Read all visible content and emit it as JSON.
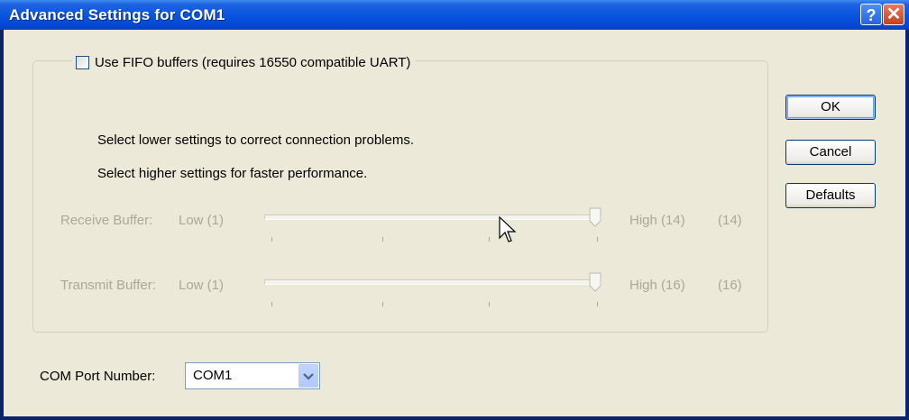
{
  "window": {
    "title": "Advanced Settings for COM1",
    "help_glyph": "?",
    "close_glyph": "✕"
  },
  "fifo": {
    "checkbox_label": "Use FIFO buffers (requires 16550 compatible UART)",
    "checked": false,
    "hint_lower": "Select lower settings to correct connection problems.",
    "hint_higher": "Select higher settings for faster performance.",
    "receive": {
      "label": "Receive Buffer:",
      "low_label": "Low (1)",
      "high_label": "High (14)",
      "value_label": "(14)",
      "level": 1.0
    },
    "transmit": {
      "label": "Transmit Buffer:",
      "low_label": "Low (1)",
      "high_label": "High (16)",
      "value_label": "(16)",
      "level": 1.0
    }
  },
  "buttons": {
    "ok": "OK",
    "cancel": "Cancel",
    "defaults": "Defaults"
  },
  "com_port": {
    "label": "COM Port Number:",
    "value": "COM1"
  },
  "colors": {
    "titlebar": "#0a55e0",
    "dialog_bg": "#ece9d8",
    "disabled_text": "#aca899"
  }
}
